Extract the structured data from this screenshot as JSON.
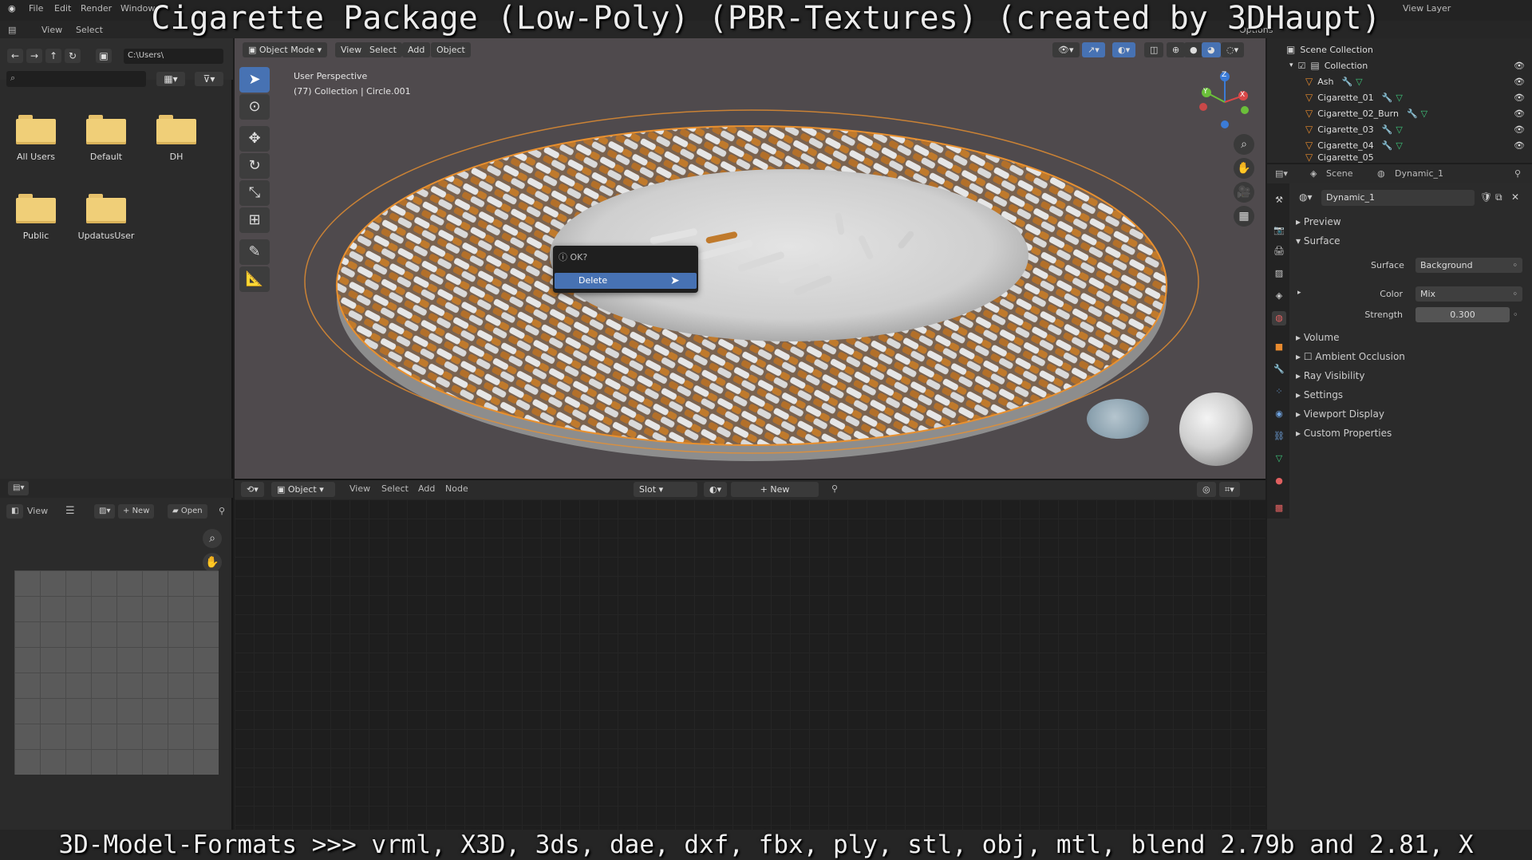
{
  "overlay": {
    "title": "Cigarette Package (Low-Poly) (PBR-Textures) (created by 3DHaupt)",
    "formats": "3D-Model-Formats >>> vrml, X3D, 3ds, dae, dxf, fbx, ply, stl, obj, mtl, blend 2.79b and 2.81, X"
  },
  "topbar": {
    "menus": [
      "File",
      "Edit",
      "Render",
      "Window"
    ],
    "view_layer": "View Layer",
    "options": "Options"
  },
  "subbar": {
    "view": "View",
    "select": "Select"
  },
  "file_browser": {
    "path": "C:\\Users\\",
    "folders": [
      "All Users",
      "Default",
      "DH",
      "Public",
      "UpdatusUser"
    ]
  },
  "viewport": {
    "mode": "Object Mode",
    "menus": [
      "View",
      "Select",
      "Add",
      "Object"
    ],
    "info_line1": "User Perspective",
    "info_line2": "(77) Collection | Circle.001",
    "gizmo_axes": {
      "z": "Z",
      "y": "Y",
      "x": "X"
    }
  },
  "dialog": {
    "question": "OK?",
    "action": "Delete"
  },
  "node_editor": {
    "object_type": "Object",
    "menus": [
      "View",
      "Select",
      "Add",
      "Node"
    ],
    "slot": "Slot",
    "new_label": "New"
  },
  "image_editor": {
    "view": "View",
    "new_label": "New",
    "open_label": "Open"
  },
  "outliner": {
    "scene_collection": "Scene Collection",
    "collection": "Collection",
    "items": [
      "Ash",
      "Cigarette_01",
      "Cigarette_02_Burn",
      "Cigarette_03",
      "Cigarette_04",
      "Cigarette_05"
    ]
  },
  "properties": {
    "scene": "Scene",
    "world": "Dynamic_1",
    "world_field": "Dynamic_1",
    "panels_top": [
      "Preview",
      "Surface"
    ],
    "surface_label": "Surface",
    "surface_value": "Background",
    "color_label": "Color",
    "color_value": "Mix",
    "strength_label": "Strength",
    "strength_value": "0.300",
    "panels_bottom": [
      "Volume",
      "Ambient Occlusion",
      "Ray Visibility",
      "Settings",
      "Viewport Display",
      "Custom Properties"
    ]
  },
  "colors": {
    "accent_blue": "#4772b3",
    "viewport_bg": "#4f4a4d",
    "orange_select": "#e8902f",
    "folder_yellow": "#f0cf78"
  }
}
